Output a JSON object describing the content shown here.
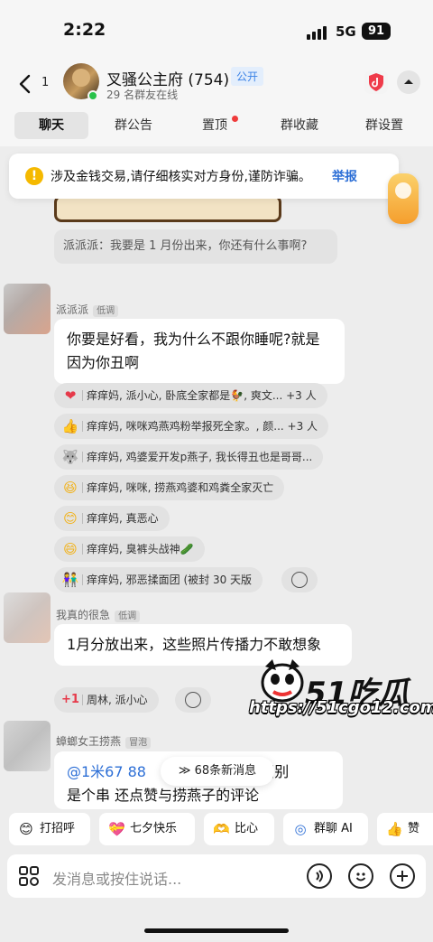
{
  "status": {
    "time": "2:22",
    "network": "5G",
    "battery": "91"
  },
  "header": {
    "unread_count": "1",
    "group_name": "叉骚公主府 (754)",
    "public_tag": "公开",
    "online": "29 名群友在线"
  },
  "tabs": [
    "聊天",
    "群公告",
    "置顶",
    "群收藏",
    "群设置"
  ],
  "warning": {
    "text": "涉及金钱交易,请仔细核实对方身份,谨防诈骗。",
    "link": "举报"
  },
  "messages": {
    "reply_quote": "派派派：我要是 1 月份出来，你还有什么事啊?",
    "msg1": {
      "sender": "派派派",
      "role": "低调",
      "text": "你要是好看，我为什么不跟你睡呢?就是因为你丑啊",
      "reactions": [
        {
          "icon": "heart-icon",
          "emoji": "❤",
          "color": "#e63a4a",
          "text": "痒痒妈, 派小心, 卧底全家都是🐓, 爽文... +3 人"
        },
        {
          "icon": "thumbs-up-icon",
          "emoji": "👍",
          "color": "#f2b21a",
          "text": "痒痒妈, 咪咪鸡燕鸡粉举报死全家。, 颜... +3 人"
        },
        {
          "icon": "husky-icon",
          "emoji": "🐺",
          "color": "#556",
          "text": "痒痒妈, 鸡婆爱开发p燕子, 我长得丑也是哥哥..."
        },
        {
          "icon": "laughing-face-icon",
          "emoji": "😆",
          "color": "#f2b21a",
          "text": "痒痒妈, 咪咪, 捞燕鸡婆和鸡粪全家灭亡"
        },
        {
          "icon": "smiling-face-icon",
          "emoji": "😊",
          "color": "#f2b21a",
          "text": "痒痒妈, 真恶心"
        },
        {
          "icon": "grinning-face-icon",
          "emoji": "😄",
          "color": "#f2b21a",
          "text": "痒痒妈, 臭裤头战神🥒"
        },
        {
          "icon": "group-icon",
          "emoji": "👫",
          "color": "#e77",
          "text": "痒痒妈, 邪恶揉面团 (被封 30 天版"
        }
      ]
    },
    "msg2": {
      "sender": "我真的很急",
      "role": "低调",
      "text": "1月分放出来，这些照片传播力不敢想象",
      "reactions": [
        {
          "icon": "plus-one-icon",
          "emoji": "+1",
          "color": "#e63a4a",
          "text": "周林, 派小心"
        }
      ]
    },
    "msg3": {
      "sender": "蟑螂女王捞燕",
      "role": "冒泡",
      "mention": "@1米67 88",
      "text_tail": "昭昭别",
      "line2": "是个串 还点赞与捞燕子的评论"
    }
  },
  "new_messages": "68条新消息",
  "quick_actions": [
    {
      "icon": "wave-icon",
      "emoji": "😊",
      "label": "打招呼"
    },
    {
      "icon": "qixi-icon",
      "emoji": "💝",
      "label": "七夕快乐"
    },
    {
      "icon": "heart-hands-icon",
      "emoji": "🫶",
      "label": "比心"
    },
    {
      "icon": "ai-icon",
      "emoji": "◎",
      "label": "群聊 AI"
    },
    {
      "icon": "like-icon",
      "emoji": "👍",
      "label": "赞"
    }
  ],
  "input": {
    "placeholder": "发消息或按住说话..."
  },
  "watermark": {
    "brand": "51吃瓜",
    "url": "https://51cgo12.com"
  }
}
